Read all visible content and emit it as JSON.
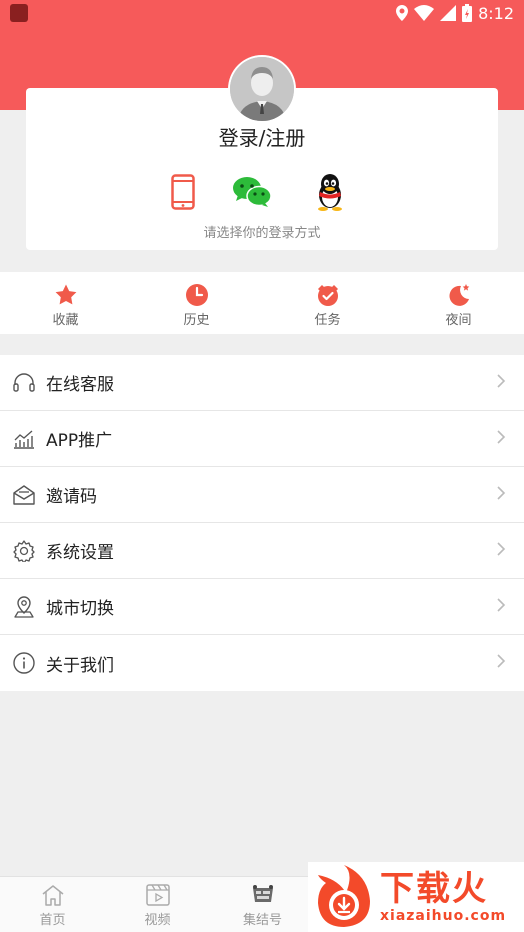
{
  "status_bar": {
    "time": "8:12"
  },
  "login": {
    "title": "登录/注册",
    "hint": "请选择你的登录方式",
    "methods": [
      "phone-icon",
      "wechat-icon",
      "qq-icon"
    ]
  },
  "quick_actions": [
    {
      "label": "收藏",
      "icon": "star-icon"
    },
    {
      "label": "历史",
      "icon": "clock-icon"
    },
    {
      "label": "任务",
      "icon": "alarm-icon"
    },
    {
      "label": "夜间",
      "icon": "moon-icon"
    }
  ],
  "menu": [
    {
      "label": "在线客服",
      "icon": "headset-icon"
    },
    {
      "label": "APP推广",
      "icon": "chart-icon"
    },
    {
      "label": "邀请码",
      "icon": "envelope-icon"
    },
    {
      "label": "系统设置",
      "icon": "gear-icon"
    },
    {
      "label": "城市切换",
      "icon": "location-icon"
    },
    {
      "label": "关于我们",
      "icon": "info-icon"
    }
  ],
  "tabbar": [
    {
      "label": "首页",
      "icon": "home-icon"
    },
    {
      "label": "视频",
      "icon": "video-icon"
    },
    {
      "label": "集结号",
      "icon": "badge-icon"
    }
  ],
  "watermark": {
    "name": "下载火",
    "url": "xiazaihuo.com"
  },
  "colors": {
    "brand": "#f65a5a",
    "accent": "#f05a4a",
    "muted": "#999999"
  }
}
